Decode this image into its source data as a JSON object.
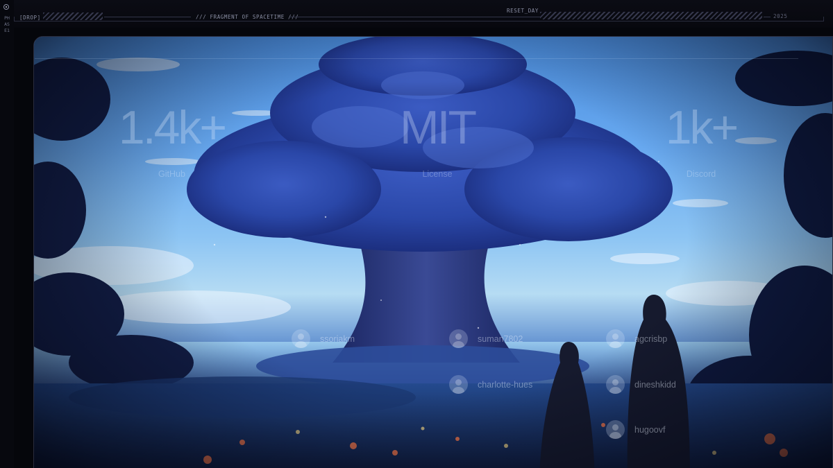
{
  "hud": {
    "drop_tag": "[DROP]",
    "fragment_label": "/// FRAGMENT OF SPACETIME ///",
    "reset_label": "RESET_DAY",
    "year": "2025",
    "phase_label": "PHASE1"
  },
  "stats": [
    {
      "value": "1.4k+",
      "label": "GitHub"
    },
    {
      "value": "MIT",
      "label": "License"
    },
    {
      "value": "1k+",
      "label": "Discord"
    }
  ],
  "contributors": [
    {
      "name": "ssoriakm"
    },
    {
      "name": "suman7802"
    },
    {
      "name": "agcrisbp"
    },
    {
      "name": "charlotte-hues"
    },
    {
      "name": "dineshkidd"
    },
    {
      "name": "hugoovf"
    }
  ],
  "colors": {
    "accent": "#8a8ea3",
    "sky_top": "#4c8fe0",
    "tree_blue": "#2a47a8",
    "background": "#05060b"
  }
}
